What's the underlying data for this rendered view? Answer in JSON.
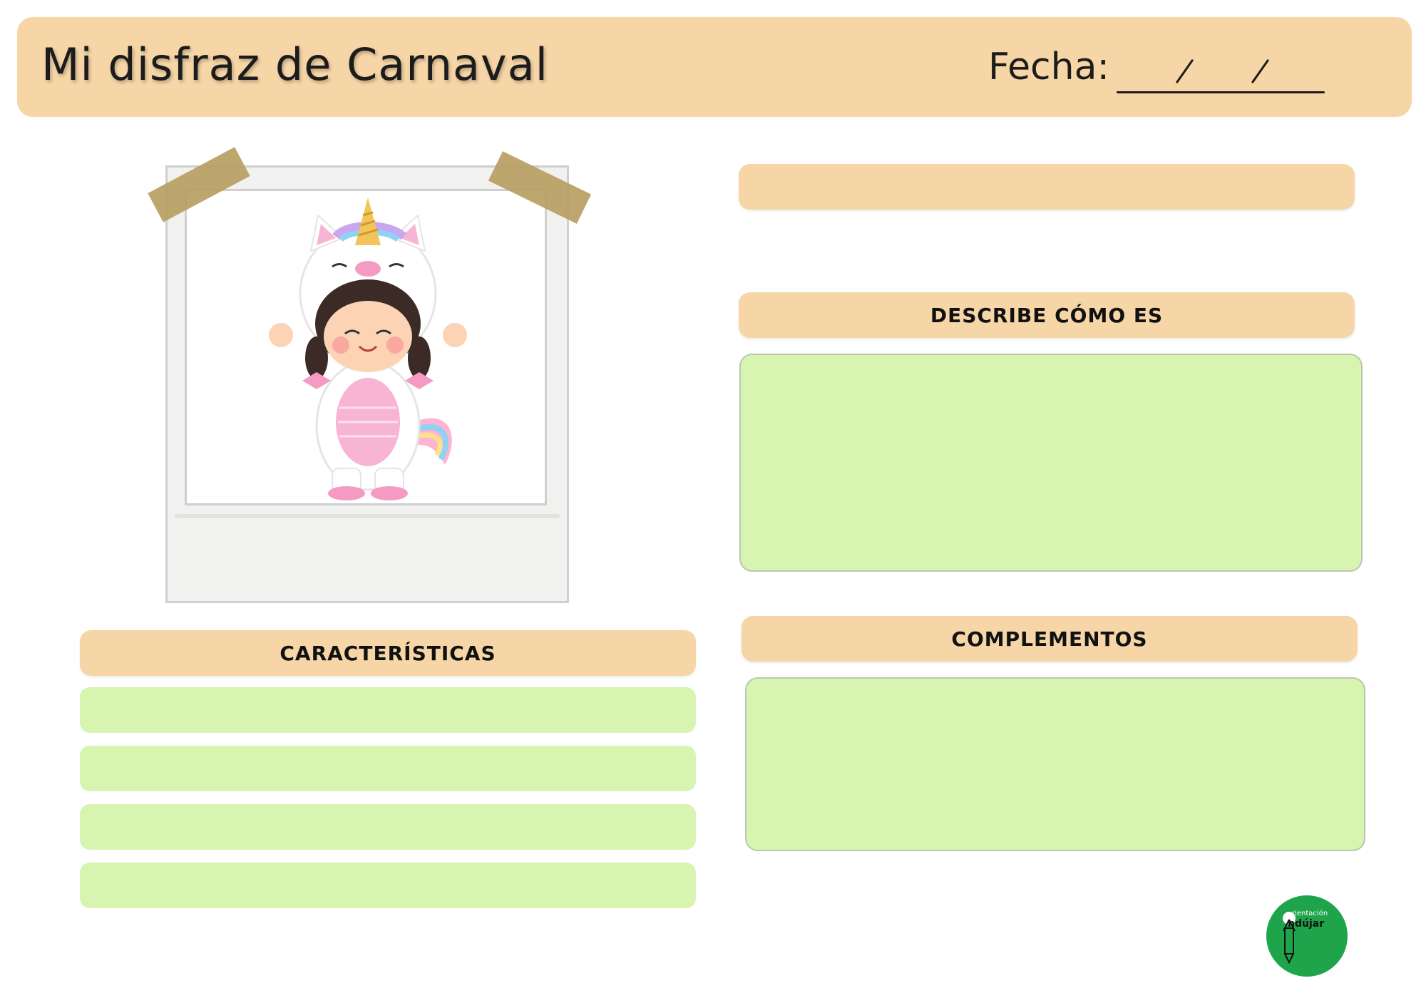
{
  "header": {
    "title": "Mi disfraz de Carnaval",
    "date_label": "Fecha:"
  },
  "sections": {
    "describe": "DESCRIBE CÓMO ES",
    "caracteristicas": "CARACTERÍSTICAS",
    "complementos": "COMPLEMENTOS"
  },
  "logo": {
    "small_text": "rientación",
    "big_text": "ndújar"
  },
  "illustration": {
    "subject": "unicorn-costume-girl-icon"
  },
  "colors": {
    "peach": "#f6d5a6",
    "green": "#d7f4b0",
    "logo_green": "#1ea44b"
  }
}
